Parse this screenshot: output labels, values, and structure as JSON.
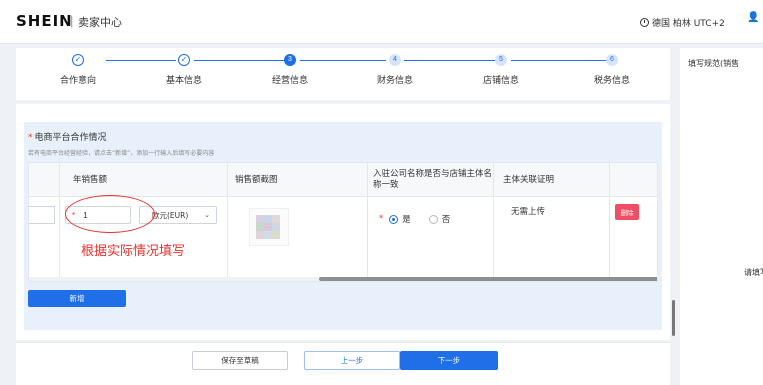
{
  "header": {
    "logo": "SHEIN",
    "separator": "|",
    "subtitle": "卖家中心",
    "timezone": "德国 柏林 UTC+2",
    "user_glyph": "👤"
  },
  "steps": [
    {
      "label": "合作意向",
      "state": "done",
      "marker": "✓"
    },
    {
      "label": "基本信息",
      "state": "done",
      "marker": "✓"
    },
    {
      "label": "经营信息",
      "state": "active",
      "marker": "3"
    },
    {
      "label": "财务信息",
      "state": "todo",
      "marker": "4"
    },
    {
      "label": "店铺信息",
      "state": "todo",
      "marker": "5"
    },
    {
      "label": "税务信息",
      "state": "todo",
      "marker": "6"
    }
  ],
  "right_panel": {
    "title": "填写规范(销售",
    "hint": "请填写"
  },
  "section": {
    "required_mark": "*",
    "title": "电商平台合作情况",
    "hint": "若有电商平台经营经验，请点击“新增”，添加一行输入后填写必要内容"
  },
  "table": {
    "headers": {
      "annual_sales": "年销售额",
      "sales_screenshot": "销售额截图",
      "name_consistent": "入驻公司名称是否与店铺主体名称一致",
      "subject_proof": "主体关联证明"
    },
    "row": {
      "amount_required": "*",
      "amount_value": "1",
      "currency": "欧元(EUR)",
      "radio_required": "*",
      "radio_yes": "是",
      "radio_no": "否",
      "proof_text": "无需上传",
      "delete_label": "删除"
    }
  },
  "annotation": "根据实际情况填写",
  "buttons": {
    "add": "新增",
    "save_draft": "保存至草稿",
    "prev": "上一步",
    "next": "下一步"
  },
  "colors": {
    "primary": "#1e6fe8",
    "danger": "#f04f63",
    "annotation": "#e8322c"
  }
}
